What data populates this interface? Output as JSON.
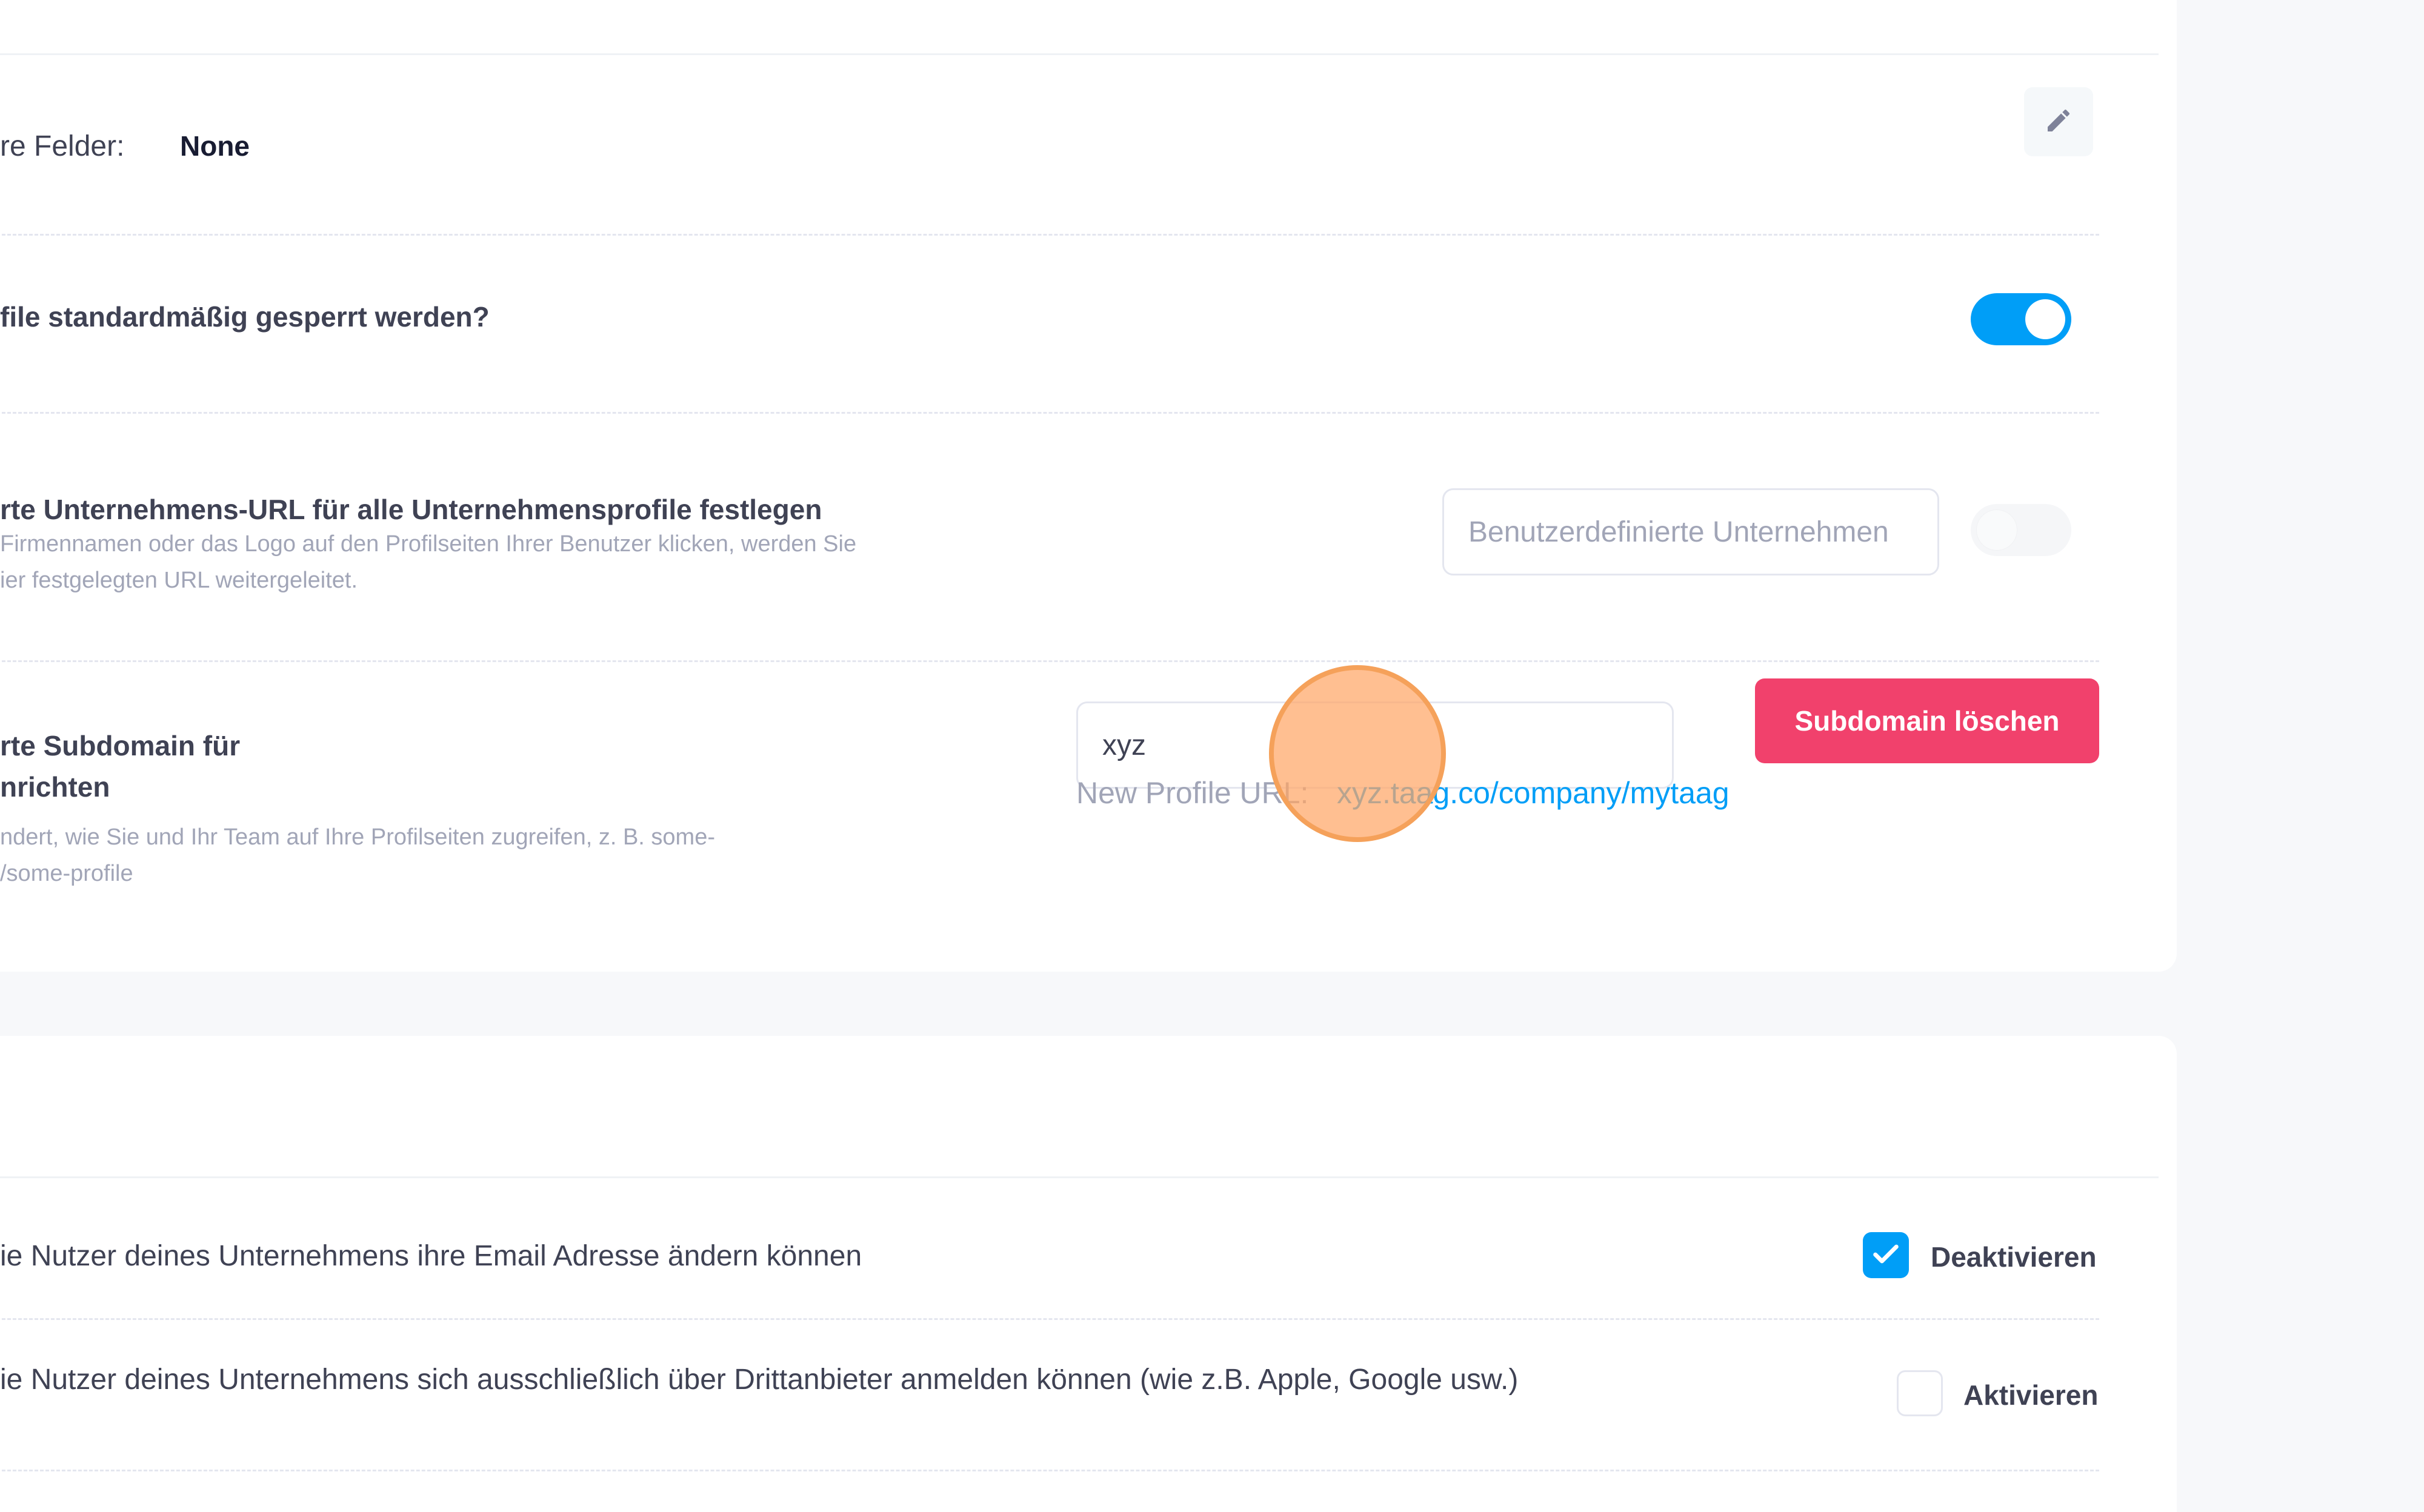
{
  "settings": {
    "custom_fields": {
      "label": "re Felder:",
      "value": "None",
      "edit_icon": "pencil-icon"
    },
    "lock_profiles": {
      "label": "file standardmäßig gesperrt werden?",
      "toggle_state": "on"
    },
    "company_url": {
      "label": "rte Unternehmens-URL für alle Unternehmensprofile festlegen",
      "desc_line1": "Firmennamen oder das Logo auf den Profilseiten Ihrer Benutzer klicken, werden Sie",
      "desc_line2": "ier festgelegten URL weitergeleitet.",
      "input_placeholder": "Benutzerdefinierte Unternehmen",
      "toggle_state": "off"
    },
    "subdomain": {
      "label_line1": "rte Subdomain für",
      "label_line2": "nrichten",
      "desc_line1": "ndert, wie Sie und Ihr Team auf Ihre Profilseiten zugreifen, z. B. some-",
      "desc_line2": "/some-profile",
      "input_value": "xyz",
      "delete_button": "Subdomain löschen",
      "url_label": "New Profile URL:",
      "url_value": "xyz.taag.co/company/mytaag"
    }
  },
  "permissions": {
    "email_change": {
      "label": "ie Nutzer deines Unternehmens ihre Email Adresse ändern können",
      "checkbox_label": "Deaktivieren",
      "checked": true
    },
    "third_party_login": {
      "label": "ie Nutzer deines Unternehmens sich ausschließlich über Drittanbieter anmelden können (wie z.B. Apple, Google usw.)",
      "checkbox_label": "Aktivieren",
      "checked": false
    }
  },
  "colors": {
    "primary": "#009ef7",
    "danger": "#f1416c",
    "cursor_highlight": "#ffa666"
  }
}
